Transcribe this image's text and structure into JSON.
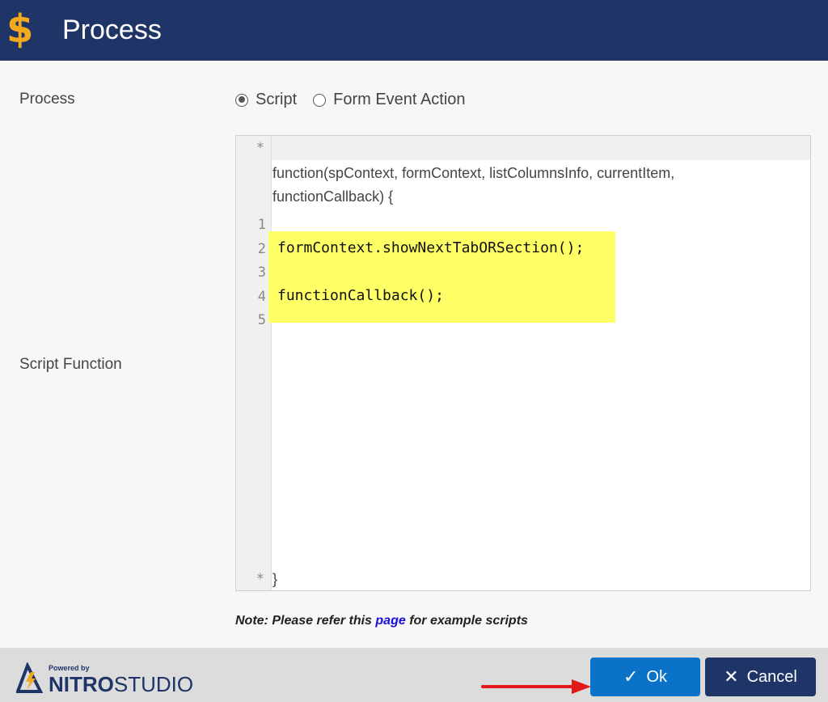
{
  "header": {
    "title": "Process",
    "icon": "dollar-icon",
    "bg": "#1f3568",
    "icon_color": "#f2a91d"
  },
  "form": {
    "process_label": "Process",
    "script_function_label": "Script Function",
    "radios": [
      {
        "label": "Script",
        "selected": true
      },
      {
        "label": "Form Event Action",
        "selected": false
      }
    ]
  },
  "editor": {
    "gutter_top": "*",
    "gutter_bottom": "*",
    "comment_lines": [
      "function(spContext, formContext, listColumnsInfo, currentItem,",
      "functionCallback) {"
    ],
    "line_numbers": [
      "1",
      "2",
      "3",
      "4",
      "5"
    ],
    "code_lines": [
      "",
      "formContext.showNextTabORSection();",
      "",
      "functionCallback();",
      ""
    ],
    "closing": "}"
  },
  "note": {
    "prefix": "Note: Please refer this",
    "link": "page",
    "suffix": "for example scripts"
  },
  "footer": {
    "powered_by": "Powered by",
    "brand_nitro": "NITRO",
    "brand_studio": "STUDIO",
    "ok_label": "Ok",
    "cancel_label": "Cancel"
  }
}
